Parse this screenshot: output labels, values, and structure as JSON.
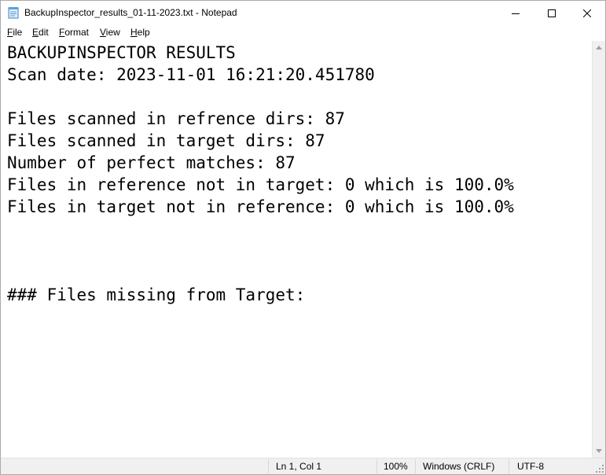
{
  "window": {
    "title": "BackupInspector_results_01-11-2023.txt - Notepad",
    "icon": "notepad-icon",
    "controls": [
      "minimize-icon",
      "maximize-icon",
      "close-icon"
    ]
  },
  "menu": [
    {
      "accel": "F",
      "rest": "ile"
    },
    {
      "accel": "E",
      "rest": "dit"
    },
    {
      "accel": "F",
      "rest": "ormat"
    },
    {
      "accel": "V",
      "rest": "iew"
    },
    {
      "accel": "H",
      "rest": "elp"
    }
  ],
  "editor": {
    "lines": [
      "BACKUPINSPECTOR RESULTS",
      "Scan date: 2023-11-01 16:21:20.451780",
      "",
      "Files scanned in refrence dirs: 87",
      "Files scanned in target dirs: 87",
      "Number of perfect matches: 87",
      "Files in reference not in target: 0 which is 100.0%",
      "Files in target not in reference: 0 which is 100.0%",
      "",
      "",
      "",
      "### Files missing from Target:"
    ]
  },
  "status": {
    "position": "Ln 1, Col 1",
    "zoom": "100%",
    "line_ending": "Windows (CRLF)",
    "encoding": "UTF-8"
  }
}
